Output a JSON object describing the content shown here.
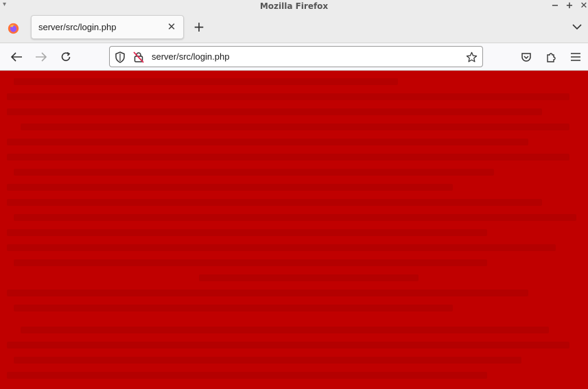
{
  "window": {
    "title": "Mozilla Firefox"
  },
  "tab": {
    "title": "server/src/login.php"
  },
  "urlbar": {
    "url": "server/src/login.php"
  },
  "icons": {
    "menu": "window-menu-icon",
    "minimize": "minimize-icon",
    "maximize": "maximize-icon",
    "close": "close-icon",
    "firefox": "firefox-logo-icon",
    "tab_close": "tab-close-icon",
    "new_tab": "new-tab-icon",
    "list_tabs": "chevron-down-icon",
    "back": "back-arrow-icon",
    "forward": "forward-arrow-icon",
    "reload": "reload-icon",
    "tracking": "shield-icon",
    "insecure": "insecure-lock-icon",
    "bookmark": "star-icon",
    "pocket": "pocket-icon",
    "extensions": "extensions-icon",
    "app_menu": "hamburger-menu-icon"
  },
  "colors": {
    "page_background": "#c00000",
    "chrome": "#ececec"
  }
}
